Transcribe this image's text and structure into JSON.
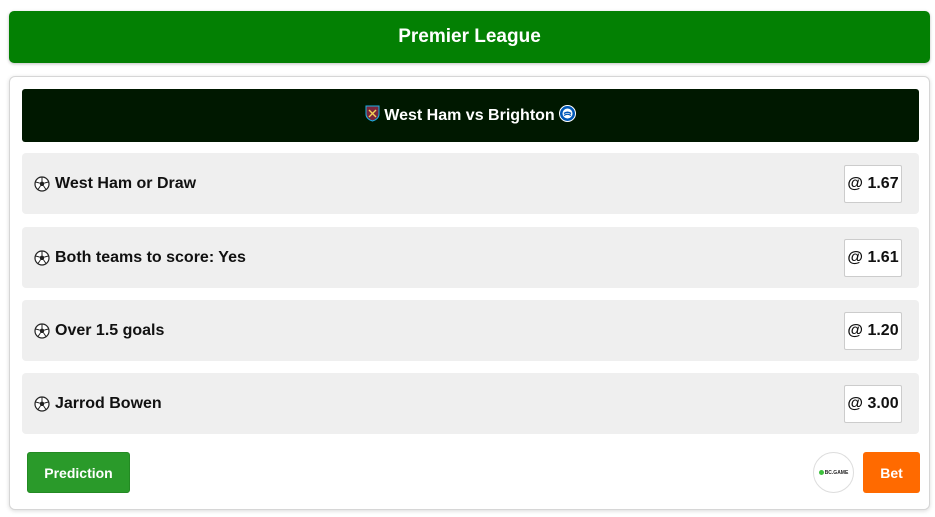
{
  "header": {
    "title": "Premier League"
  },
  "match": {
    "title": "West Ham vs Brighton",
    "home_crest": "west-ham-crest-icon",
    "away_crest": "brighton-crest-icon"
  },
  "bets": [
    {
      "label": "West Ham or Draw",
      "odds": "@ 1.67",
      "icon": "soccer-ball-icon"
    },
    {
      "label": "Both teams to score: Yes",
      "odds": "@ 1.61",
      "icon": "soccer-ball-icon"
    },
    {
      "label": "Over 1.5 goals",
      "odds": "@ 1.20",
      "icon": "soccer-ball-icon"
    },
    {
      "label": "Jarrod Bowen",
      "odds": "@ 3.00",
      "icon": "soccer-ball-icon"
    }
  ],
  "actions": {
    "prediction_label": "Prediction",
    "bet_label": "Bet",
    "bookmaker_logo_text": "BC.GAME"
  },
  "colors": {
    "header_green": "#038003",
    "match_bar": "#001800",
    "prediction_green": "#2a9a2a",
    "bet_orange": "#ff6a00",
    "row_bg": "#efefef"
  }
}
